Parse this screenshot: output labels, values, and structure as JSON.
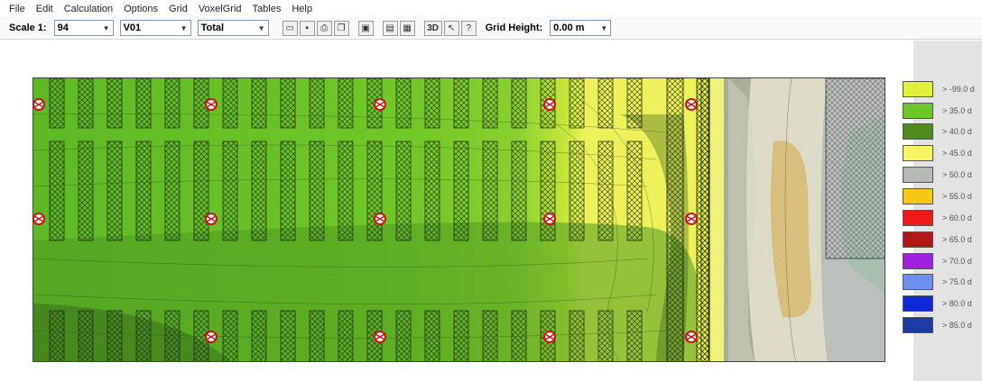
{
  "menu": [
    "File",
    "Edit",
    "Calculation",
    "Options",
    "Grid",
    "VoxelGrid",
    "Tables",
    "Help"
  ],
  "toolbar": {
    "scale_label": "Scale 1:",
    "scale_value": "94",
    "variant_value": "V01",
    "mode_value": "Total",
    "btn_3d": "3D",
    "grid_height_label": "Grid Height:",
    "grid_height_value": "0.00 m"
  },
  "legend": [
    {
      "label": "> -99.0 d",
      "color": "#e2f23a"
    },
    {
      "label": "> 35.0 d",
      "color": "#6cc828"
    },
    {
      "label": "> 40.0 d",
      "color": "#4e8a1e"
    },
    {
      "label": "> 45.0 d",
      "color": "#f4f560"
    },
    {
      "label": "> 50.0 d",
      "color": "#b4b9b4"
    },
    {
      "label": "> 55.0 d",
      "color": "#f7c816"
    },
    {
      "label": "> 60.0 d",
      "color": "#ee1a1a"
    },
    {
      "label": "> 65.0 d",
      "color": "#b01818"
    },
    {
      "label": "> 70.0 d",
      "color": "#a020e0"
    },
    {
      "label": "> 75.0 d",
      "color": "#6c8ff0"
    },
    {
      "label": "> 80.0 d",
      "color": "#1028d8"
    },
    {
      "label": "> 85.0 d",
      "color": "#1c3aa0"
    }
  ]
}
